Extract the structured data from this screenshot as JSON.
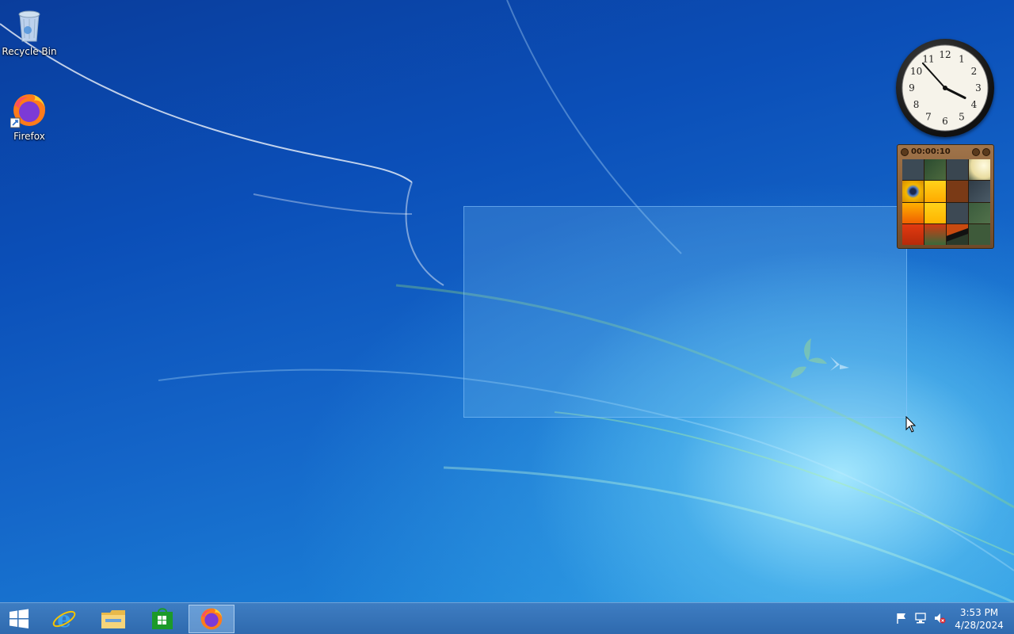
{
  "desktop": {
    "icons": [
      {
        "label": "Recycle Bin",
        "icon": "recycle-bin-icon"
      },
      {
        "label": "Firefox",
        "icon": "firefox-icon"
      }
    ]
  },
  "gadgets": {
    "clock": {
      "hour": 3,
      "minute": 53,
      "numerals": [
        "12",
        "1",
        "2",
        "3",
        "4",
        "5",
        "6",
        "7",
        "8",
        "9",
        "10",
        "11"
      ]
    },
    "puzzle": {
      "timer": "00:00:10"
    }
  },
  "taskbar": {
    "buttons": [
      {
        "name": "start-button",
        "icon": "windows-logo-icon"
      },
      {
        "name": "internet-explorer-button",
        "icon": "internet-explorer-icon"
      },
      {
        "name": "file-explorer-button",
        "icon": "folder-icon"
      },
      {
        "name": "store-button",
        "icon": "store-icon"
      },
      {
        "name": "firefox-taskbar-button",
        "icon": "firefox-icon",
        "active": true
      }
    ],
    "tray": {
      "icons": [
        "action-center-flag-icon",
        "network-icon",
        "volume-muted-icon"
      ],
      "time": "3:53 PM",
      "date": "4/28/2024"
    }
  },
  "colors": {
    "taskbar": "#3565a9",
    "selection": "#78bef0"
  }
}
